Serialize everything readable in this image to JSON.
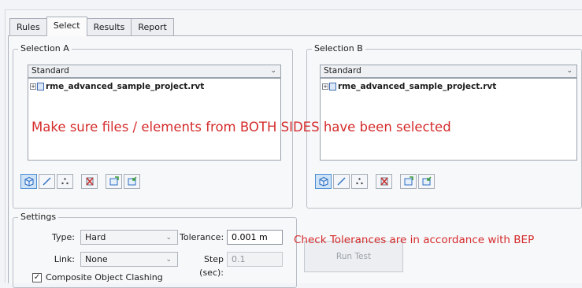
{
  "tabs": [
    {
      "label": "Rules",
      "active": false
    },
    {
      "label": "Select",
      "active": true
    },
    {
      "label": "Results",
      "active": false
    },
    {
      "label": "Report",
      "active": false
    }
  ],
  "selection_a": {
    "title": "Selection A",
    "mode": "Standard",
    "tree_item": "rme_advanced_sample_project.rvt"
  },
  "selection_b": {
    "title": "Selection B",
    "mode": "Standard",
    "tree_item": "rme_advanced_sample_project.rvt"
  },
  "annotation_selection": "Make sure files / elements from BOTH SIDES have been selected",
  "annotation_tolerance": "Check Tolerances are in accordance with BEP",
  "settings": {
    "title": "Settings",
    "type_label": "Type:",
    "type_value": "Hard",
    "tolerance_label": "Tolerance:",
    "tolerance_value": "0.001 m",
    "link_label": "Link:",
    "link_value": "None",
    "step_label": "Step (sec):",
    "step_value": "0.1",
    "composite_label": "Composite Object Clashing",
    "composite_checked": true
  },
  "run_test_label": "Run Test",
  "colors": {
    "annotation": "#d52c2c",
    "pressed_button": "#cfe3f7",
    "icon_blue": "#2f6fc4",
    "icon_green": "#3b9a3b",
    "icon_red": "#c9302c"
  }
}
